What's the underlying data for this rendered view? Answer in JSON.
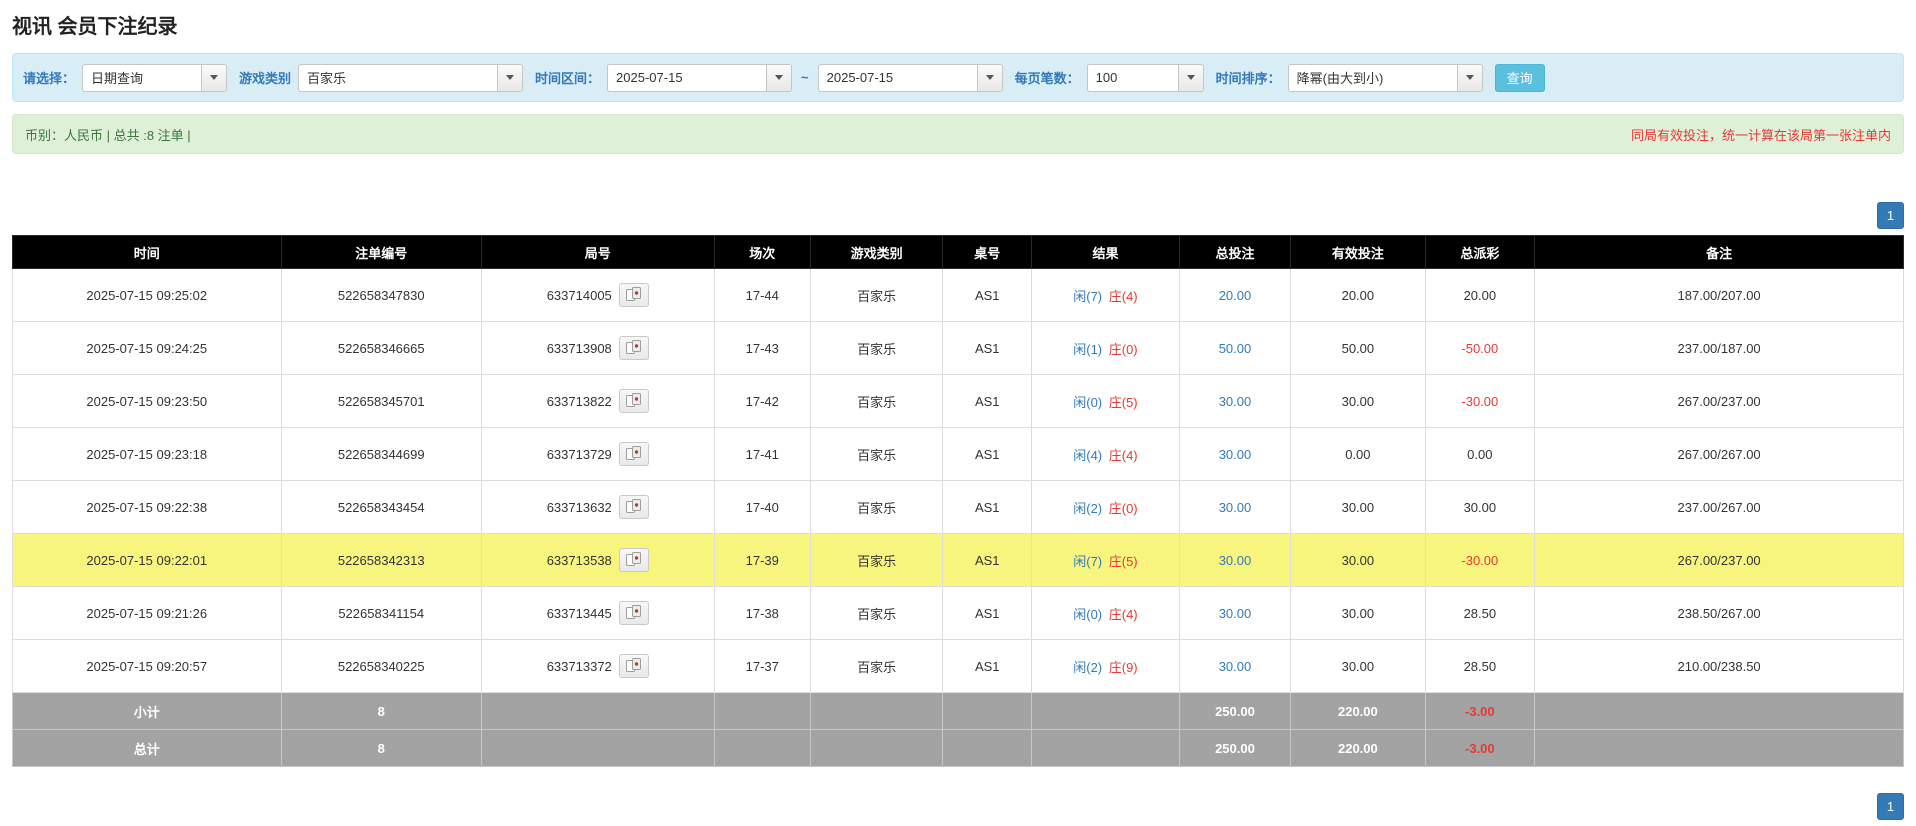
{
  "page": {
    "title": "视讯 会员下注纪录"
  },
  "filters": {
    "select_label": "请选择：",
    "select_value": "日期查询",
    "game_label": "游戏类别",
    "game_value": "百家乐",
    "range_label": "时间区间：",
    "date_from": "2025-07-15",
    "range_separator": "~",
    "date_to": "2025-07-15",
    "per_page_label": "每页笔数：",
    "per_page_value": "100",
    "sort_label": "时间排序：",
    "sort_value": "降幂(由大到小)",
    "search_button": "查询"
  },
  "info_bar": {
    "summary": "币别：人民币 | 总共 :8 注单 |",
    "notice": "同局有效投注，统一计算在该局第一张注单内"
  },
  "pagination": {
    "page_top": "1",
    "page_bottom": "1"
  },
  "table": {
    "headers": [
      "时间",
      "注单编号",
      "局号",
      "场次",
      "游戏类别",
      "桌号",
      "结果",
      "总投注",
      "有效投注",
      "总派彩",
      "备注"
    ],
    "rows": [
      {
        "time": "2025-07-15 09:25:02",
        "bet_id": "522658347830",
        "round_id": "633714005",
        "session": "17-44",
        "game": "百家乐",
        "table_no": "AS1",
        "result_player": "闲(7)",
        "result_banker": "庄(4)",
        "total_bet": "20.00",
        "valid_bet": "20.00",
        "payout": "20.00",
        "remark": "187.00/207.00",
        "highlight": false
      },
      {
        "time": "2025-07-15 09:24:25",
        "bet_id": "522658346665",
        "round_id": "633713908",
        "session": "17-43",
        "game": "百家乐",
        "table_no": "AS1",
        "result_player": "闲(1)",
        "result_banker": "庄(0)",
        "total_bet": "50.00",
        "valid_bet": "50.00",
        "payout": "-50.00",
        "remark": "237.00/187.00",
        "highlight": false
      },
      {
        "time": "2025-07-15 09:23:50",
        "bet_id": "522658345701",
        "round_id": "633713822",
        "session": "17-42",
        "game": "百家乐",
        "table_no": "AS1",
        "result_player": "闲(0)",
        "result_banker": "庄(5)",
        "total_bet": "30.00",
        "valid_bet": "30.00",
        "payout": "-30.00",
        "remark": "267.00/237.00",
        "highlight": false
      },
      {
        "time": "2025-07-15 09:23:18",
        "bet_id": "522658344699",
        "round_id": "633713729",
        "session": "17-41",
        "game": "百家乐",
        "table_no": "AS1",
        "result_player": "闲(4)",
        "result_banker": "庄(4)",
        "total_bet": "30.00",
        "valid_bet": "0.00",
        "payout": "0.00",
        "remark": "267.00/267.00",
        "highlight": false
      },
      {
        "time": "2025-07-15 09:22:38",
        "bet_id": "522658343454",
        "round_id": "633713632",
        "session": "17-40",
        "game": "百家乐",
        "table_no": "AS1",
        "result_player": "闲(2)",
        "result_banker": "庄(0)",
        "total_bet": "30.00",
        "valid_bet": "30.00",
        "payout": "30.00",
        "remark": "237.00/267.00",
        "highlight": false
      },
      {
        "time": "2025-07-15 09:22:01",
        "bet_id": "522658342313",
        "round_id": "633713538",
        "session": "17-39",
        "game": "百家乐",
        "table_no": "AS1",
        "result_player": "闲(7)",
        "result_banker": "庄(5)",
        "total_bet": "30.00",
        "valid_bet": "30.00",
        "payout": "-30.00",
        "remark": "267.00/237.00",
        "highlight": true
      },
      {
        "time": "2025-07-15 09:21:26",
        "bet_id": "522658341154",
        "round_id": "633713445",
        "session": "17-38",
        "game": "百家乐",
        "table_no": "AS1",
        "result_player": "闲(0)",
        "result_banker": "庄(4)",
        "total_bet": "30.00",
        "valid_bet": "30.00",
        "payout": "28.50",
        "remark": "238.50/267.00",
        "highlight": false
      },
      {
        "time": "2025-07-15 09:20:57",
        "bet_id": "522658340225",
        "round_id": "633713372",
        "session": "17-37",
        "game": "百家乐",
        "table_no": "AS1",
        "result_player": "闲(2)",
        "result_banker": "庄(9)",
        "total_bet": "30.00",
        "valid_bet": "30.00",
        "payout": "28.50",
        "remark": "210.00/238.50",
        "highlight": false
      }
    ],
    "footer": [
      {
        "label": "小计",
        "count": "8",
        "total_bet": "250.00",
        "valid_bet": "220.00",
        "payout": "-3.00"
      },
      {
        "label": "总计",
        "count": "8",
        "total_bet": "250.00",
        "valid_bet": "220.00",
        "payout": "-3.00"
      }
    ]
  },
  "colors": {
    "accent_blue": "#337ab7",
    "negative_red": "#e53935",
    "highlight_yellow": "#f8f57e",
    "header_black": "#000000",
    "filter_bar_bg": "#d9edf7",
    "info_bar_bg": "#dff0d8",
    "summary_row_bg": "#a3a3a3",
    "search_button_bg": "#5bc0de"
  }
}
